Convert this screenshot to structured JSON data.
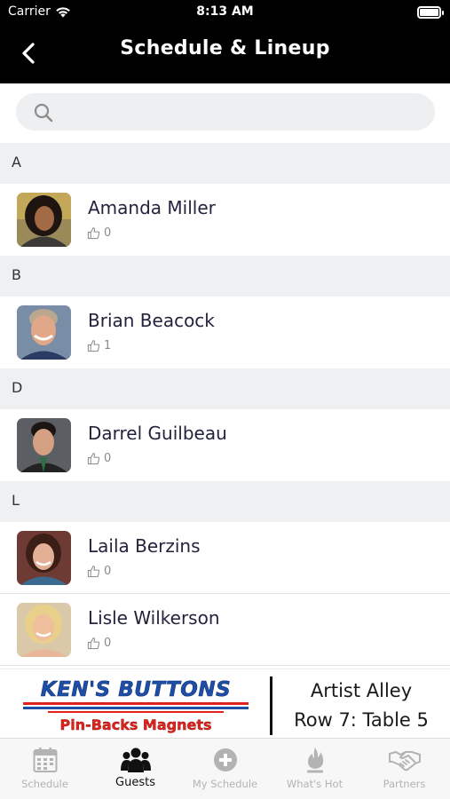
{
  "status_bar": {
    "carrier": "Carrier",
    "time": "8:13 AM"
  },
  "nav": {
    "title": "Schedule & Lineup"
  },
  "search": {
    "placeholder": "",
    "value": ""
  },
  "sections": [
    {
      "letter": "A",
      "guests": [
        {
          "name": "Amanda Miller",
          "likes": "0"
        }
      ]
    },
    {
      "letter": "B",
      "guests": [
        {
          "name": "Brian Beacock",
          "likes": "1"
        }
      ]
    },
    {
      "letter": "D",
      "guests": [
        {
          "name": "Darrel Guilbeau",
          "likes": "0"
        }
      ]
    },
    {
      "letter": "L",
      "guests": [
        {
          "name": "Laila Berzins",
          "likes": "0"
        },
        {
          "name": "Lisle Wilkerson",
          "likes": "0"
        }
      ]
    }
  ],
  "banner": {
    "logo_text": "KEN'S BUTTONS",
    "logo_sub": "Pin-Backs   Magnets",
    "location_line1": "Artist Alley",
    "location_line2": "Row 7: Table 5"
  },
  "tabs": [
    {
      "label": "Schedule",
      "icon": "calendar-icon"
    },
    {
      "label": "Guests",
      "icon": "people-icon",
      "active": true
    },
    {
      "label": "My Schedule",
      "icon": "plus-circle-icon"
    },
    {
      "label": "What's Hot",
      "icon": "flame-icon"
    },
    {
      "label": "Partners",
      "icon": "handshake-icon"
    }
  ],
  "colors": {
    "nav_bg": "#000000",
    "section_bg": "#eef0f1",
    "logo_blue": "#1d4fa8",
    "logo_red": "#e0231c",
    "tab_active": "#111111",
    "tab_inactive": "#b3b3b3"
  }
}
